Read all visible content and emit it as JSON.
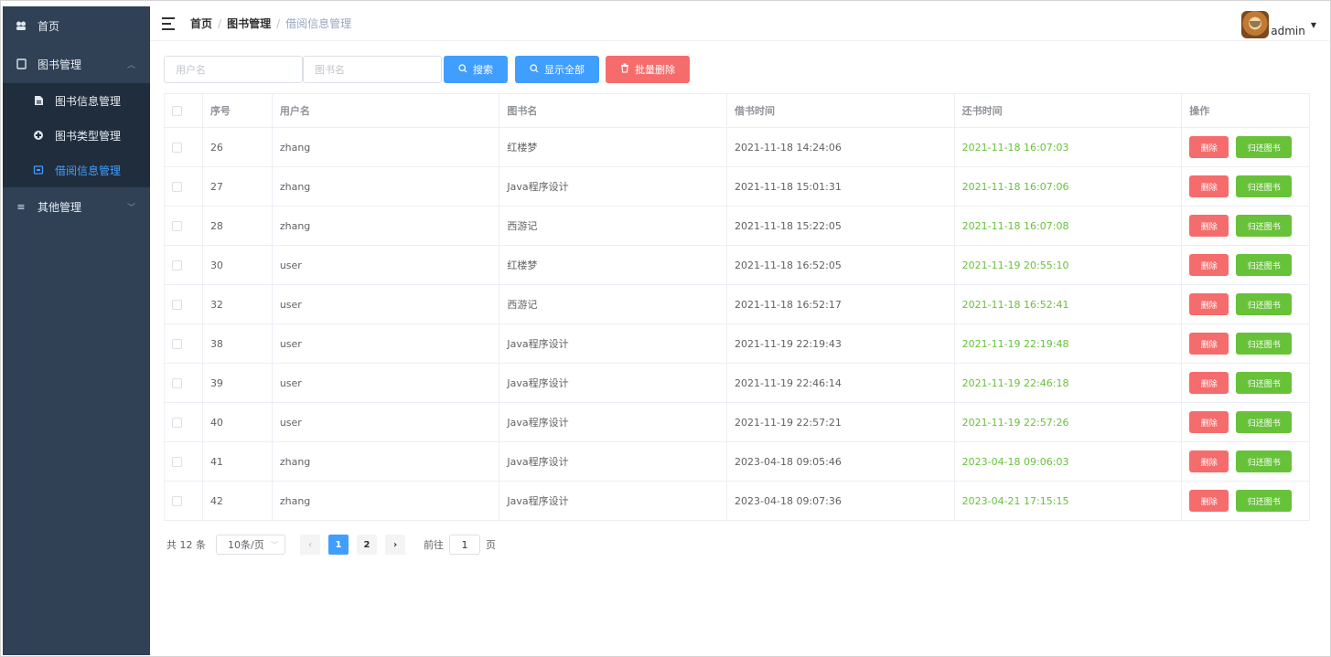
{
  "sidebar": {
    "items": [
      {
        "label": "首页",
        "icon": "dashboard-icon"
      },
      {
        "label": "图书管理",
        "icon": "document-icon",
        "expanded": true,
        "children": [
          {
            "label": "图书信息管理",
            "icon": "book-info-icon"
          },
          {
            "label": "图书类型管理",
            "icon": "category-icon"
          },
          {
            "label": "借阅信息管理",
            "icon": "borrow-icon",
            "active": true
          }
        ]
      },
      {
        "label": "其他管理",
        "icon": "menu-icon",
        "expanded": false
      }
    ]
  },
  "navbar": {
    "breadcrumb": [
      "首页",
      "图书管理",
      "借阅信息管理"
    ],
    "separator": "/",
    "user": "admin"
  },
  "toolbar": {
    "username_placeholder": "用户名",
    "bookname_placeholder": "图书名",
    "search_label": "搜索",
    "show_all_label": "显示全部",
    "bulk_delete_label": "批量删除"
  },
  "table": {
    "headers": [
      "序号",
      "用户名",
      "图书名",
      "借书时间",
      "还书时间",
      "操作"
    ],
    "rows": [
      {
        "id": "26",
        "user": "zhang",
        "book": "红楼梦",
        "borrow": "2021-11-18 14:24:06",
        "return": "2021-11-18 16:07:03"
      },
      {
        "id": "27",
        "user": "zhang",
        "book": "Java程序设计",
        "borrow": "2021-11-18 15:01:31",
        "return": "2021-11-18 16:07:06"
      },
      {
        "id": "28",
        "user": "zhang",
        "book": "西游记",
        "borrow": "2021-11-18 15:22:05",
        "return": "2021-11-18 16:07:08"
      },
      {
        "id": "30",
        "user": "user",
        "book": "红楼梦",
        "borrow": "2021-11-18 16:52:05",
        "return": "2021-11-19 20:55:10"
      },
      {
        "id": "32",
        "user": "user",
        "book": "西游记",
        "borrow": "2021-11-18 16:52:17",
        "return": "2021-11-18 16:52:41"
      },
      {
        "id": "38",
        "user": "user",
        "book": "Java程序设计",
        "borrow": "2021-11-19 22:19:43",
        "return": "2021-11-19 22:19:48"
      },
      {
        "id": "39",
        "user": "user",
        "book": "Java程序设计",
        "borrow": "2021-11-19 22:46:14",
        "return": "2021-11-19 22:46:18"
      },
      {
        "id": "40",
        "user": "user",
        "book": "Java程序设计",
        "borrow": "2021-11-19 22:57:21",
        "return": "2021-11-19 22:57:26"
      },
      {
        "id": "41",
        "user": "zhang",
        "book": "Java程序设计",
        "borrow": "2023-04-18 09:05:46",
        "return": "2023-04-18 09:06:03"
      },
      {
        "id": "42",
        "user": "zhang",
        "book": "Java程序设计",
        "borrow": "2023-04-18 09:07:36",
        "return": "2023-04-21 17:15:15"
      }
    ],
    "delete_label": "删除",
    "return_label": "归还图书"
  },
  "pagination": {
    "total": "共 12 条",
    "page_size": "10条/页",
    "pages": [
      "1",
      "2"
    ],
    "current": "1",
    "prev": "‹",
    "next": "›",
    "goto_label": "前往",
    "goto_value": "1",
    "page_unit": "页"
  },
  "colors": {
    "sidebar_bg": "#304156",
    "submenu_bg": "#1f2d3d",
    "primary": "#409eff",
    "danger": "#f56c6c",
    "success": "#67c23a"
  }
}
